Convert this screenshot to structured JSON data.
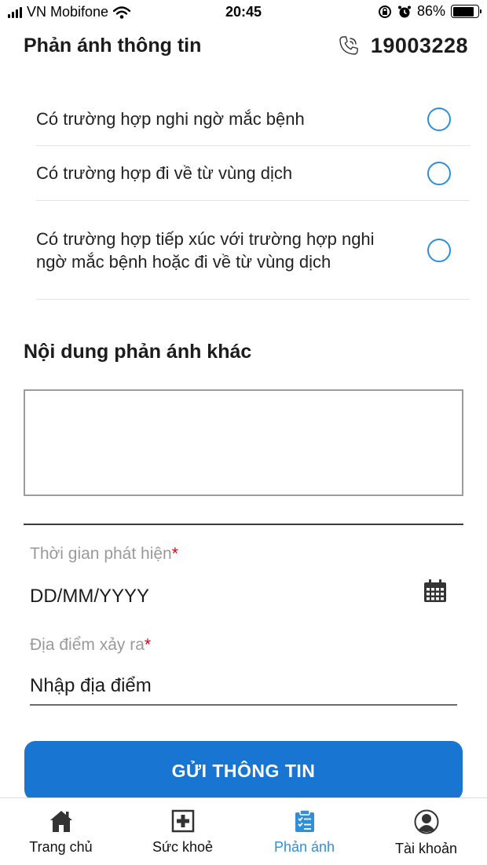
{
  "status_bar": {
    "carrier": "VN Mobifone",
    "time": "20:45",
    "battery": "86%",
    "battery_level": 0.86
  },
  "header": {
    "title": "Phản ánh thông tin",
    "hotline": "19003228",
    "hotline_icon": "phone-icon"
  },
  "options": [
    {
      "label": "Có trường hợp nghi ngờ mắc bệnh",
      "checked": false
    },
    {
      "label": "Có trường hợp đi về từ vùng dịch",
      "checked": false
    },
    {
      "label": "Có trường hợp tiếp xúc với trường hợp nghi ngờ mắc bệnh hoặc đi về từ vùng dịch",
      "checked": false
    }
  ],
  "other_content": {
    "title": "Nội dung phản ánh khác",
    "value": ""
  },
  "detection_time": {
    "label": "Thời gian phát hiện",
    "required_mark": "*",
    "placeholder": "DD/MM/YYYY",
    "icon": "calendar-icon"
  },
  "location": {
    "label": "Địa điểm xảy ra",
    "required_mark": "*",
    "placeholder": "Nhập địa điểm"
  },
  "submit_label": "GỬI THÔNG TIN",
  "colors": {
    "primary": "#1875d1",
    "radio": "#2e8fd6",
    "tab_active": "#2f8fd8",
    "required": "#d0021b"
  },
  "tabs": [
    {
      "label": "Trang chủ",
      "icon": "home-icon",
      "active": false
    },
    {
      "label": "Sức khoẻ",
      "icon": "health-icon",
      "active": false
    },
    {
      "label": "Phản ánh",
      "icon": "clipboard-icon",
      "active": true
    },
    {
      "label": "Tài khoản",
      "icon": "account-icon",
      "active": false
    }
  ]
}
